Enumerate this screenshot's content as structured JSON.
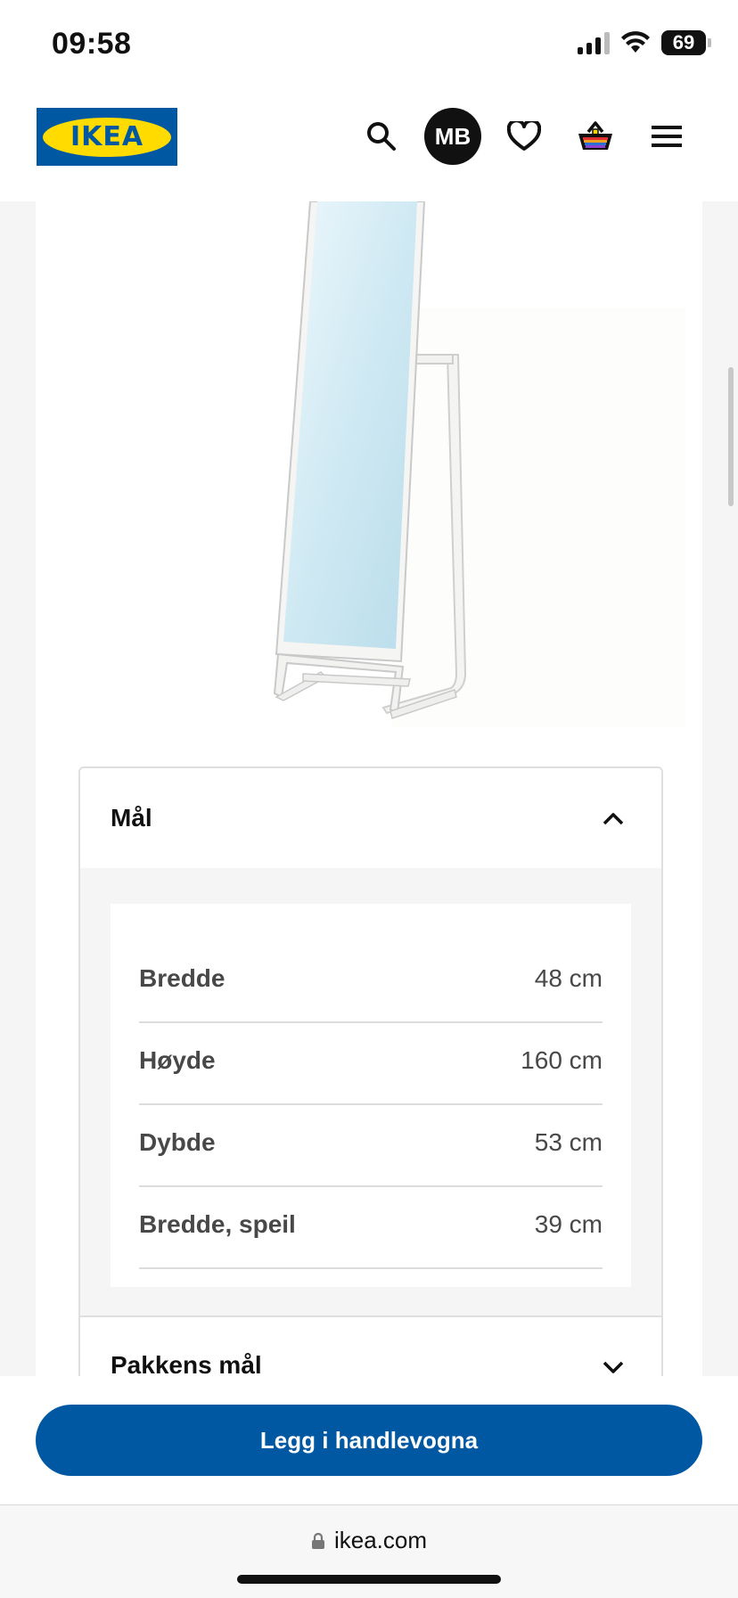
{
  "status_bar": {
    "time": "09:58",
    "battery": "69"
  },
  "header": {
    "logo_text": "IKEA",
    "avatar_initials": "MB",
    "icons": [
      "search-icon",
      "avatar",
      "heart-icon",
      "basket-icon",
      "hamburger-menu-icon"
    ]
  },
  "product": {
    "image_alt": "Standing mirror with white frame"
  },
  "accordion": {
    "title": "Mål",
    "dimensions": [
      {
        "label": "Bredde",
        "value": "48 cm"
      },
      {
        "label": "Høyde",
        "value": "160 cm"
      },
      {
        "label": "Dybde",
        "value": "53 cm"
      },
      {
        "label": "Bredde, speil",
        "value": "39 cm"
      }
    ],
    "next_section_title": "Pakkens mål"
  },
  "cta": {
    "label": "Legg i handlevogna"
  },
  "browser": {
    "url": "ikea.com"
  },
  "colors": {
    "ikea_blue": "#0058a3",
    "ikea_yellow": "#ffdb00"
  }
}
